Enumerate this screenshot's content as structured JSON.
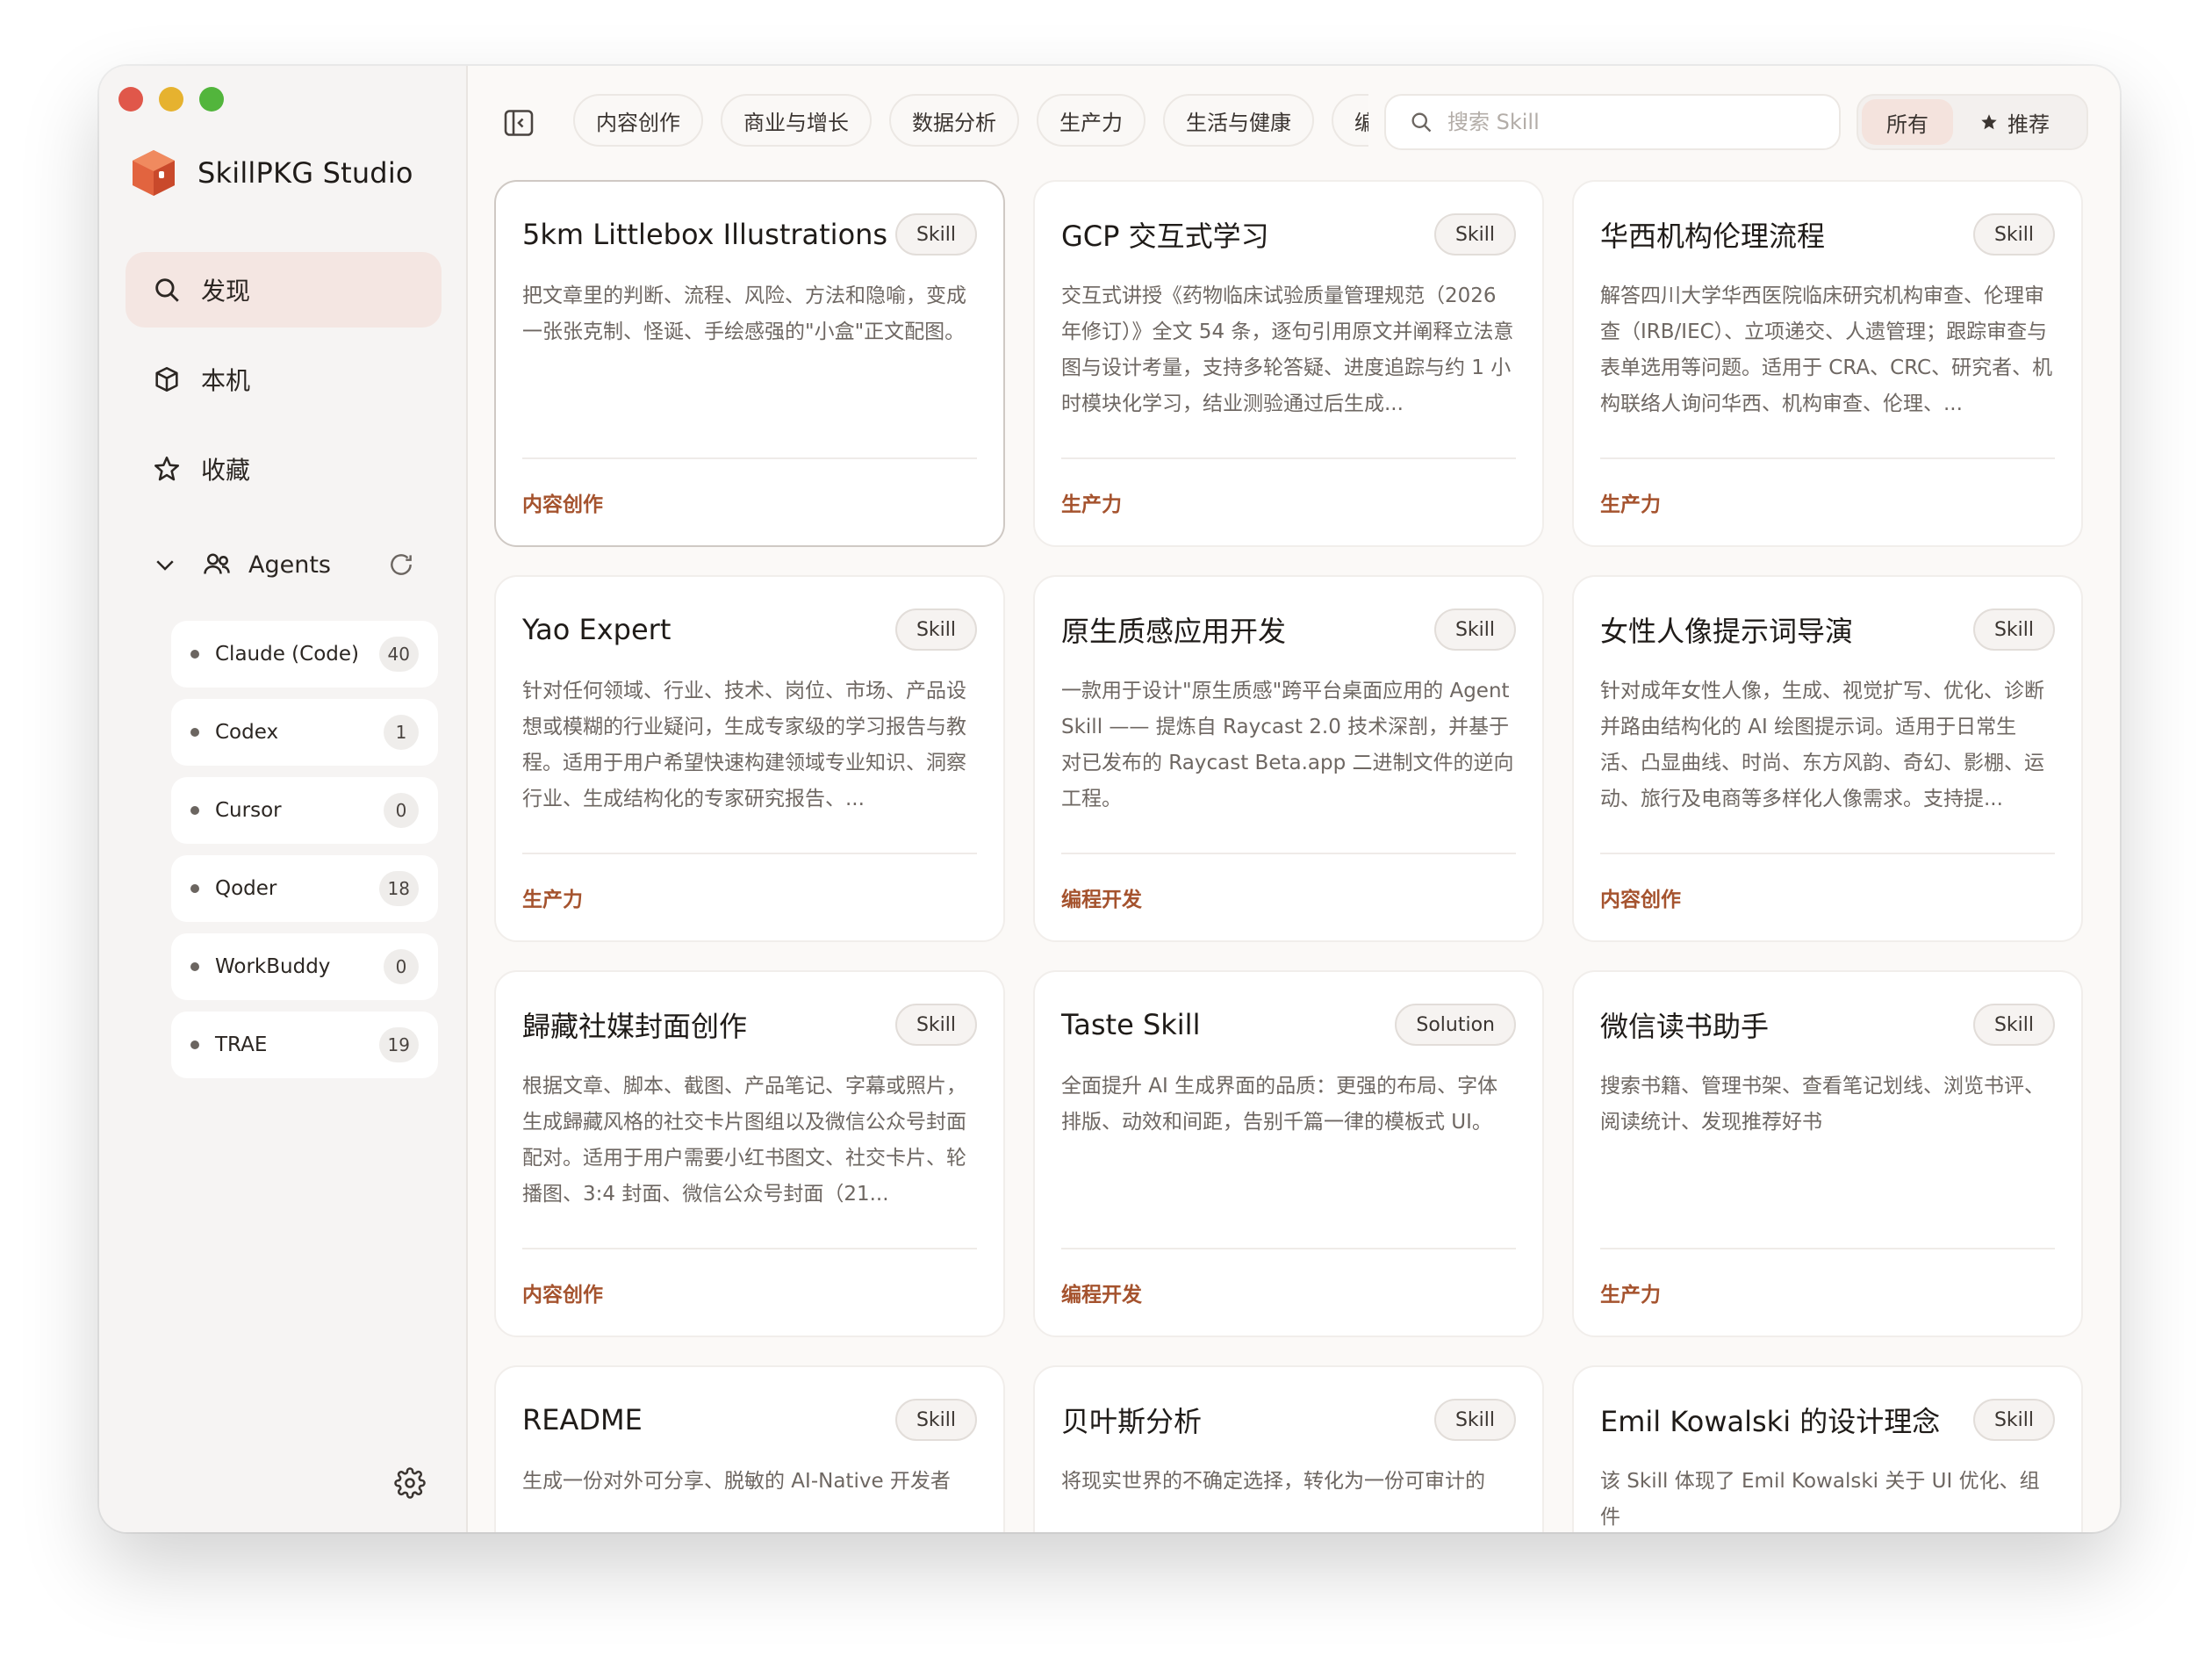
{
  "app": {
    "name": "SkillPKG Studio"
  },
  "nav": [
    {
      "label": "发现",
      "icon": "search-icon",
      "active": true
    },
    {
      "label": "本机",
      "icon": "box-icon",
      "active": false
    },
    {
      "label": "收藏",
      "icon": "star-outline-icon",
      "active": false
    }
  ],
  "agents": {
    "header": "Agents",
    "items": [
      {
        "name": "Claude (Code)",
        "count": "40"
      },
      {
        "name": "Codex",
        "count": "1"
      },
      {
        "name": "Cursor",
        "count": "0"
      },
      {
        "name": "Qoder",
        "count": "18"
      },
      {
        "name": "WorkBuddy",
        "count": "0"
      },
      {
        "name": "TRAE",
        "count": "19"
      }
    ]
  },
  "categories": [
    "内容创作",
    "商业与增长",
    "数据分析",
    "生产力",
    "生活与健康",
    "编"
  ],
  "search": {
    "placeholder": "搜索 Skill",
    "value": ""
  },
  "segment": {
    "all": "所有",
    "recommended": "推荐"
  },
  "cards": [
    {
      "title": "5km Littlebox Illustrations",
      "badge": "Skill",
      "desc": "把文章里的判断、流程、风险、方法和隐喻，变成一张张克制、怪诞、手绘感强的\"小盒\"正文配图。",
      "category": "内容创作"
    },
    {
      "title": "GCP 交互式学习",
      "badge": "Skill",
      "desc": "交互式讲授《药物临床试验质量管理规范（2026年修订）》全文 54 条，逐句引用原文并阐释立法意图与设计考量，支持多轮答疑、进度追踪与约 1 小时模块化学习，结业测验通过后生成...",
      "category": "生产力"
    },
    {
      "title": "华西机构伦理流程",
      "badge": "Skill",
      "desc": "解答四川大学华西医院临床研究机构审查、伦理审查（IRB/IEC）、立项递交、人遗管理；跟踪审查与表单选用等问题。适用于 CRA、CRC、研究者、机构联络人询问华西、机构审查、伦理、...",
      "category": "生产力"
    },
    {
      "title": "Yao Expert",
      "badge": "Skill",
      "desc": "针对任何领域、行业、技术、岗位、市场、产品设想或模糊的行业疑问，生成专家级的学习报告与教程。适用于用户希望快速构建领域专业知识、洞察行业、生成结构化的专家研究报告、...",
      "category": "生产力"
    },
    {
      "title": "原生质感应用开发",
      "badge": "Skill",
      "desc": "一款用于设计\"原生质感\"跨平台桌面应用的 Agent Skill —— 提炼自 Raycast 2.0 技术深剖，并基于对已发布的 Raycast Beta.app 二进制文件的逆向工程。",
      "category": "编程开发"
    },
    {
      "title": "女性人像提示词导演",
      "badge": "Skill",
      "desc": "针对成年女性人像，生成、视觉扩写、优化、诊断并路由结构化的 AI 绘图提示词。适用于日常生活、凸显曲线、时尚、东方风韵、奇幻、影棚、运动、旅行及电商等多样化人像需求。支持提...",
      "category": "内容创作"
    },
    {
      "title": "歸藏社媒封面创作",
      "badge": "Skill",
      "desc": "根据文章、脚本、截图、产品笔记、字幕或照片，生成歸藏风格的社交卡片图组以及微信公众号封面配对。适用于用户需要小红书图文、社交卡片、轮播图、3:4 封面、微信公众号封面（21...",
      "category": "内容创作"
    },
    {
      "title": "Taste Skill",
      "badge": "Solution",
      "desc": "全面提升 AI 生成界面的品质：更强的布局、字体排版、动效和间距，告别千篇一律的模板式 UI。",
      "category": "编程开发"
    },
    {
      "title": "微信读书助手",
      "badge": "Skill",
      "desc": "搜索书籍、管理书架、查看笔记划线、浏览书评、阅读统计、发现推荐好书",
      "category": "生产力"
    },
    {
      "title": "README",
      "badge": "Skill",
      "desc": "生成一份对外可分享、脱敏的 AI-Native 开发者",
      "category": ""
    },
    {
      "title": "贝叶斯分析",
      "badge": "Skill",
      "desc": "将现实世界的不确定选择，转化为一份可审计的",
      "category": ""
    },
    {
      "title": "Emil Kowalski 的设计理念",
      "badge": "Skill",
      "desc": "该 Skill 体现了 Emil Kowalski 关于 UI 优化、组件",
      "category": ""
    }
  ]
}
